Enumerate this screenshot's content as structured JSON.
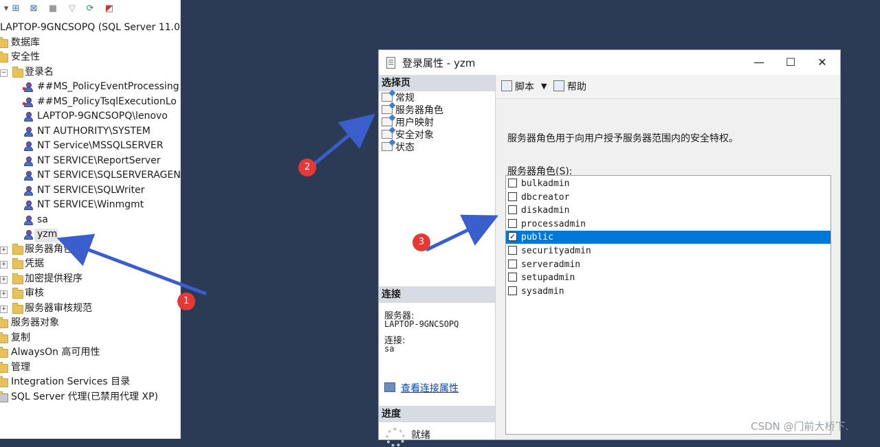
{
  "explorer": {
    "toolbar_icons": [
      "connect-icon",
      "disconnect-icon",
      "stop-icon",
      "filter-icon",
      "refresh-icon",
      "activity-monitor-icon"
    ],
    "tree": [
      {
        "label": "LAPTOP-9GNCSOPQ (SQL Server 11.0",
        "icon": "server-icon"
      },
      {
        "label": "数据库",
        "icon": "folder-icon"
      },
      {
        "label": "安全性",
        "icon": "folder-icon"
      },
      {
        "label": "登录名",
        "icon": "folder-icon",
        "expanded": true
      },
      {
        "label": "##MS_PolicyEventProcessing",
        "icon": "login-user-icon",
        "disabled": true
      },
      {
        "label": "##MS_PolicyTsqlExecutionLo",
        "icon": "login-user-icon",
        "disabled": true
      },
      {
        "label": "LAPTOP-9GNCSOPQ\\lenovo",
        "icon": "login-user-icon"
      },
      {
        "label": "NT AUTHORITY\\SYSTEM",
        "icon": "login-user-icon"
      },
      {
        "label": "NT Service\\MSSQLSERVER",
        "icon": "login-user-icon"
      },
      {
        "label": "NT SERVICE\\ReportServer",
        "icon": "login-user-icon"
      },
      {
        "label": "NT SERVICE\\SQLSERVERAGEN",
        "icon": "login-user-icon"
      },
      {
        "label": "NT SERVICE\\SQLWriter",
        "icon": "login-user-icon"
      },
      {
        "label": "NT SERVICE\\Winmgmt",
        "icon": "login-user-icon"
      },
      {
        "label": "sa",
        "icon": "login-user-icon"
      },
      {
        "label": "yzm",
        "icon": "login-user-icon",
        "selected": true
      },
      {
        "label": "服务器角色",
        "icon": "folder-icon"
      },
      {
        "label": "凭据",
        "icon": "folder-icon"
      },
      {
        "label": "加密提供程序",
        "icon": "folder-icon"
      },
      {
        "label": "审核",
        "icon": "folder-icon"
      },
      {
        "label": "服务器审核规范",
        "icon": "folder-icon"
      },
      {
        "label": "服务器对象",
        "icon": "folder-icon"
      },
      {
        "label": "复制",
        "icon": "folder-icon"
      },
      {
        "label": "AlwaysOn 高可用性",
        "icon": "folder-icon"
      },
      {
        "label": "管理",
        "icon": "folder-icon"
      },
      {
        "label": "Integration Services 目录",
        "icon": "folder-icon"
      },
      {
        "label": "SQL Server 代理(已禁用代理 XP)",
        "icon": "agent-icon"
      }
    ]
  },
  "dialog": {
    "title": "登录属性 - yzm",
    "controls": {
      "minimize": "—",
      "maximize": "☐",
      "close": "✕"
    },
    "select_page_header": "选择页",
    "pages": [
      "常规",
      "服务器角色",
      "用户映射",
      "安全对象",
      "状态"
    ],
    "connection_header": "连接",
    "server_label": "服务器:",
    "server_value": "LAPTOP-9GNCSOPQ",
    "connection_label": "连接:",
    "connection_value": "sa",
    "view_connection_link": "查看连接属性",
    "progress_header": "进度",
    "progress_status": "就绪",
    "toolbar": {
      "script": "脚本",
      "help": "帮助"
    },
    "description": "服务器角色用于向用户授予服务器范围内的安全特权。",
    "roles_label": "服务器角色(S):",
    "roles": [
      {
        "name": "bulkadmin",
        "checked": false
      },
      {
        "name": "dbcreator",
        "checked": false
      },
      {
        "name": "diskadmin",
        "checked": false
      },
      {
        "name": "processadmin",
        "checked": false
      },
      {
        "name": "public",
        "checked": true,
        "selected": true
      },
      {
        "name": "securityadmin",
        "checked": false
      },
      {
        "name": "serveradmin",
        "checked": false
      },
      {
        "name": "setupadmin",
        "checked": false
      },
      {
        "name": "sysadmin",
        "checked": false
      }
    ]
  },
  "annotations": {
    "badges": [
      "1",
      "2",
      "3"
    ],
    "arrow_color": "#3a5fcd",
    "badge_color": "#e53935"
  },
  "watermark": "CSDN @门前大桥下."
}
